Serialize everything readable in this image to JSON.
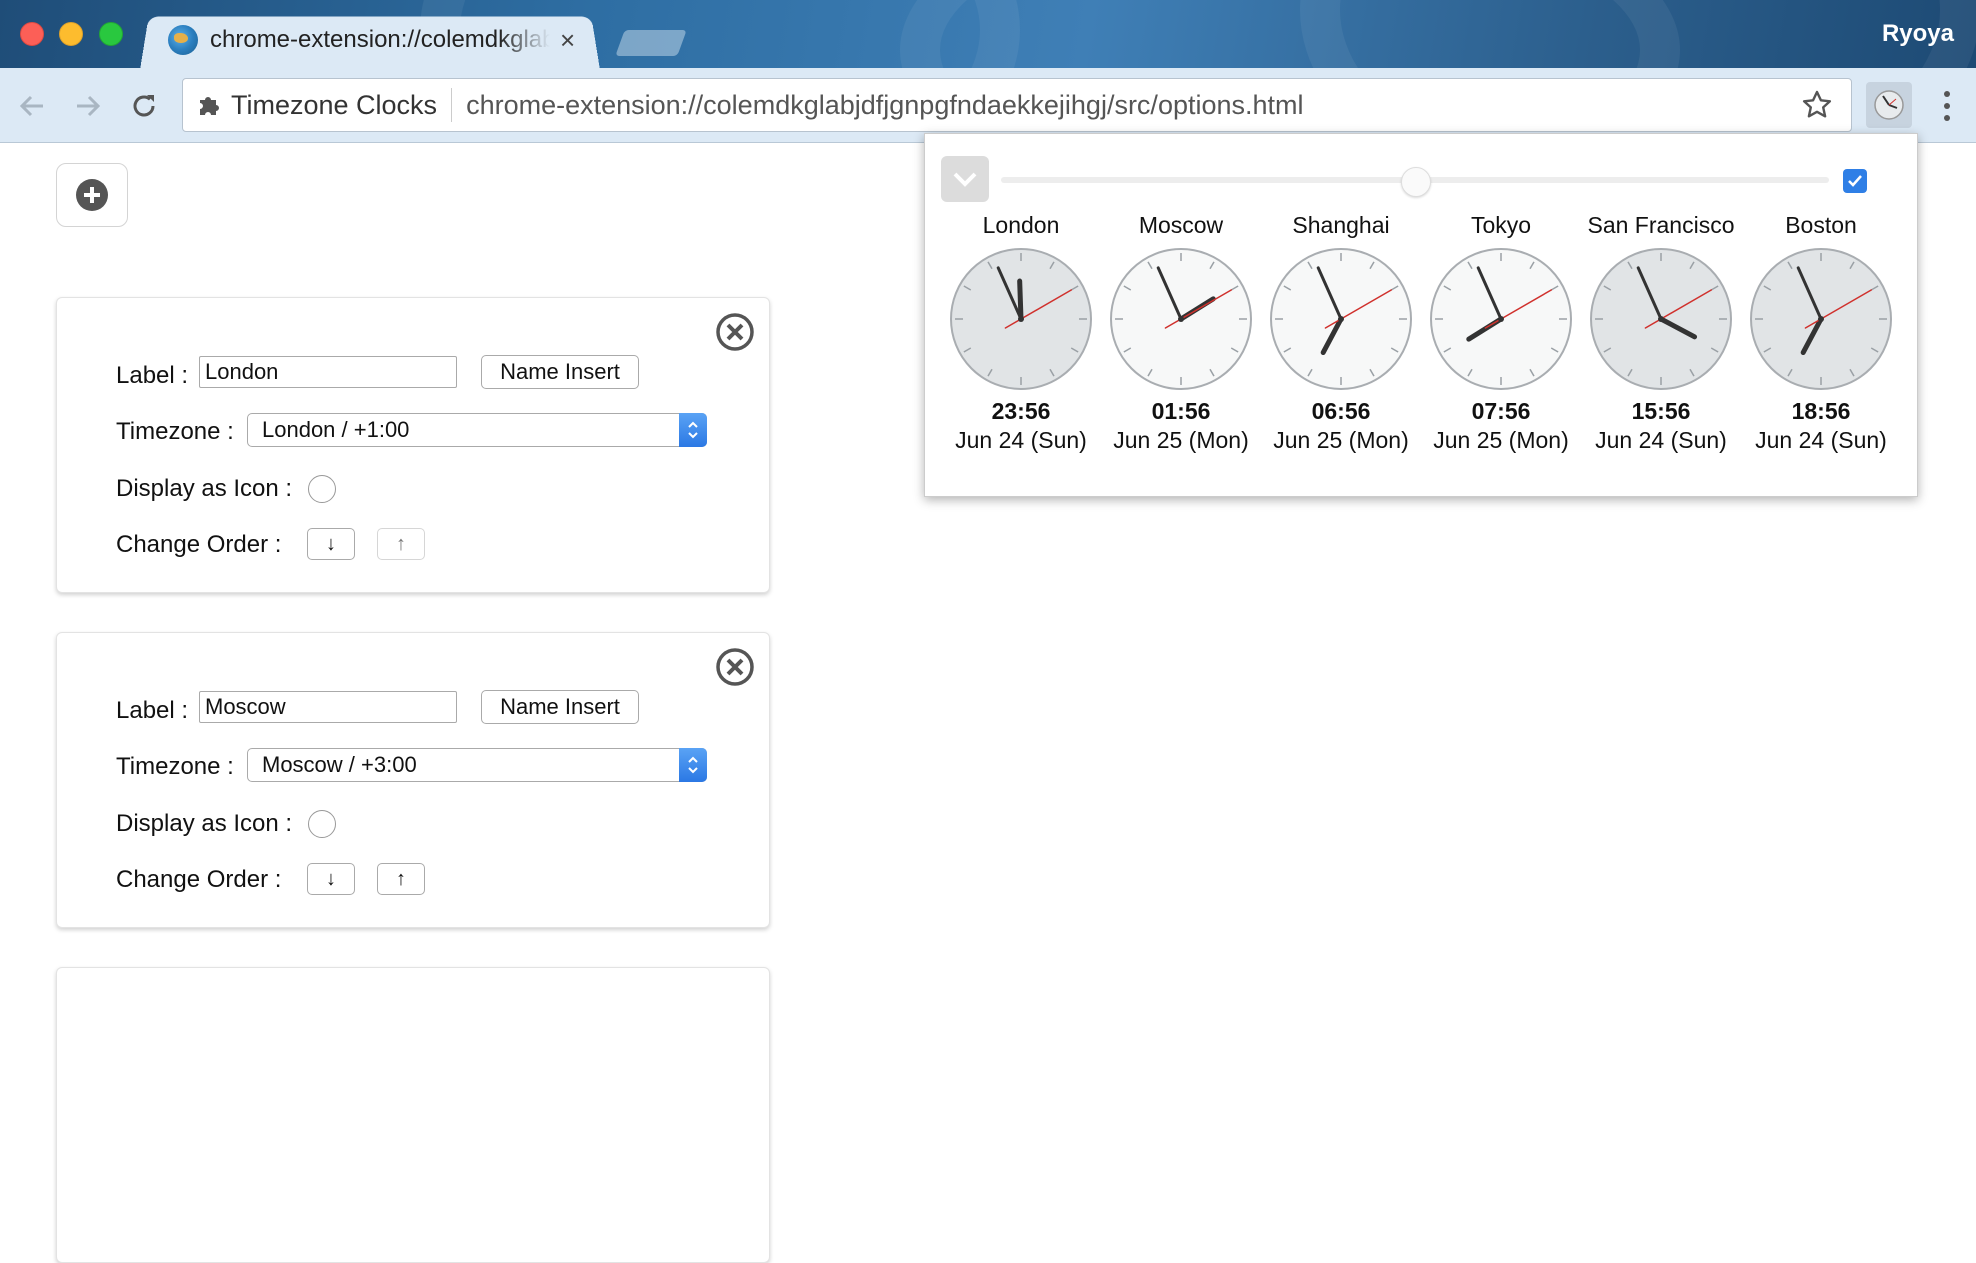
{
  "window": {
    "profile_name": "Ryoya"
  },
  "tab": {
    "title": "chrome-extension://colemdkglabjdfjgnpgfndaekkejihgj/src/options.html",
    "close_glyph": "×"
  },
  "toolbar": {
    "extension_label": "Timezone Clocks",
    "url": "chrome-extension://colemdkglabjdfjgnpgfndaekkejihgj/src/options.html"
  },
  "cards": [
    {
      "label_caption": "Label :",
      "label_value": "London",
      "name_insert": "Name Insert",
      "timezone_caption": "Timezone :",
      "timezone_value": "London / +1:00",
      "icon_caption": "Display as Icon :",
      "order_caption": "Change Order :",
      "down_glyph": "↓",
      "up_glyph": "↑",
      "up_enabled": false
    },
    {
      "label_caption": "Label :",
      "label_value": "Moscow",
      "name_insert": "Name Insert",
      "timezone_caption": "Timezone :",
      "timezone_value": "Moscow / +3:00",
      "icon_caption": "Display as Icon :",
      "order_caption": "Change Order :",
      "down_glyph": "↓",
      "up_glyph": "↑",
      "up_enabled": true
    }
  ],
  "popup": {
    "slider_fraction": 0.5,
    "checkbox_checked": true,
    "clocks": [
      {
        "name": "London",
        "time": "23:56",
        "date": "Jun 24 (Sun)",
        "hour": 23,
        "minute": 56,
        "second": 10,
        "night": true
      },
      {
        "name": "Moscow",
        "time": "01:56",
        "date": "Jun 25 (Mon)",
        "hour": 1,
        "minute": 56,
        "second": 10,
        "night": false
      },
      {
        "name": "Shanghai",
        "time": "06:56",
        "date": "Jun 25 (Mon)",
        "hour": 6,
        "minute": 56,
        "second": 10,
        "night": false
      },
      {
        "name": "Tokyo",
        "time": "07:56",
        "date": "Jun 25 (Mon)",
        "hour": 7,
        "minute": 56,
        "second": 10,
        "night": false
      },
      {
        "name": "San Francisco",
        "time": "15:56",
        "date": "Jun 24 (Sun)",
        "hour": 15,
        "minute": 56,
        "second": 10,
        "night": true
      },
      {
        "name": "Boston",
        "time": "18:56",
        "date": "Jun 24 (Sun)",
        "hour": 18,
        "minute": 56,
        "second": 10,
        "night": true
      }
    ]
  },
  "colors": {
    "second_hand": "#d0312d",
    "hand": "#333333",
    "face_day": "#f7f8f8",
    "face_night": "#e1e4e6",
    "accent": "#2f7fe6"
  },
  "icons": [
    "globe-favicon",
    "back-arrow-icon",
    "forward-arrow-icon",
    "reload-icon",
    "puzzle-icon",
    "star-icon",
    "clock-extension-icon",
    "more-menu-icon",
    "add-icon",
    "close-circle-icon",
    "chevron-down-icon",
    "checkmark-icon",
    "updown-arrows-icon"
  ]
}
